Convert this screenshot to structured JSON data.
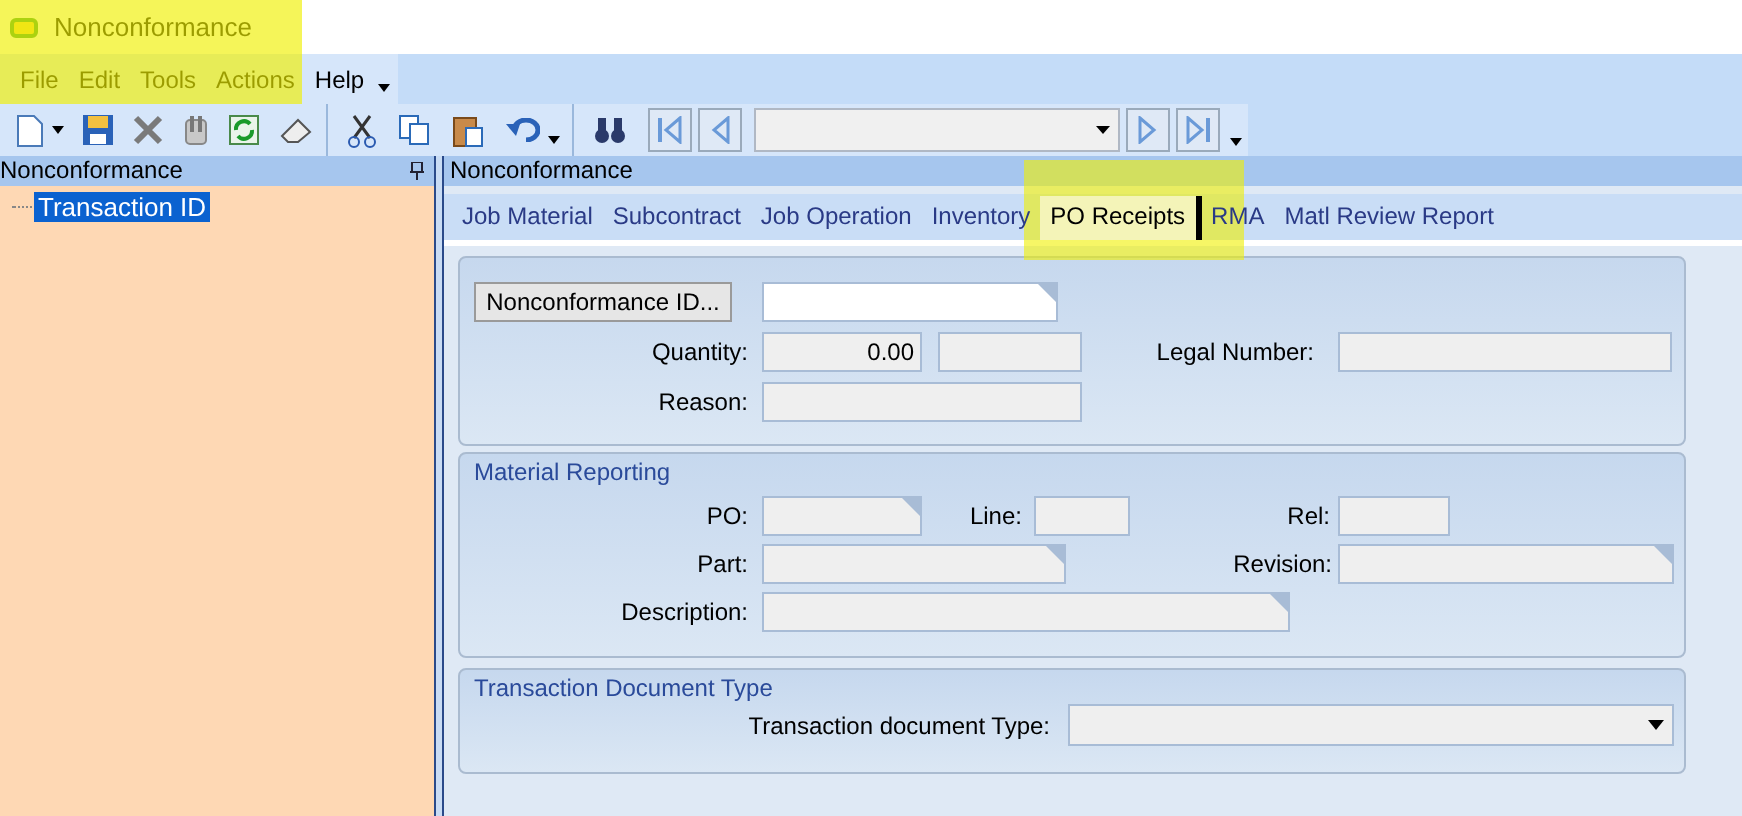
{
  "window": {
    "title": "Nonconformance",
    "highlighted": true
  },
  "menu": [
    {
      "label": "File"
    },
    {
      "label": "Edit"
    },
    {
      "label": "Tools"
    },
    {
      "label": "Actions"
    },
    {
      "label": "Help"
    }
  ],
  "left_pane": {
    "title": "Nonconformance",
    "tree": [
      {
        "label": "Transaction ID",
        "selected": true
      }
    ]
  },
  "right_pane": {
    "title": "Nonconformance",
    "tabs": [
      {
        "label": "Job Material",
        "selected": false,
        "highlighted": false
      },
      {
        "label": "Subcontract",
        "selected": false,
        "highlighted": false
      },
      {
        "label": "Job Operation",
        "selected": false,
        "highlighted": false
      },
      {
        "label": "Inventory",
        "selected": false,
        "highlighted": false
      },
      {
        "label": "PO Receipts",
        "selected": true,
        "highlighted": true
      },
      {
        "label": "RMA",
        "selected": false,
        "highlighted": false
      },
      {
        "label": "Matl Review Report",
        "selected": false,
        "highlighted": false
      }
    ]
  },
  "main_group": {
    "button": "Nonconformance ID...",
    "quantity": {
      "label": "Quantity:",
      "value": "0.00"
    },
    "legal_number": {
      "label": "Legal Number:"
    },
    "reason": {
      "label": "Reason:"
    }
  },
  "material_reporting": {
    "title": "Material Reporting",
    "po": {
      "label": "PO:"
    },
    "line": {
      "label": "Line:"
    },
    "rel": {
      "label": "Rel:"
    },
    "part": {
      "label": "Part:"
    },
    "revision": {
      "label": "Revision:"
    },
    "description": {
      "label": "Description:"
    }
  },
  "transaction_document_type": {
    "title": "Transaction Document Type",
    "field": {
      "label": "Transaction document Type:"
    }
  }
}
